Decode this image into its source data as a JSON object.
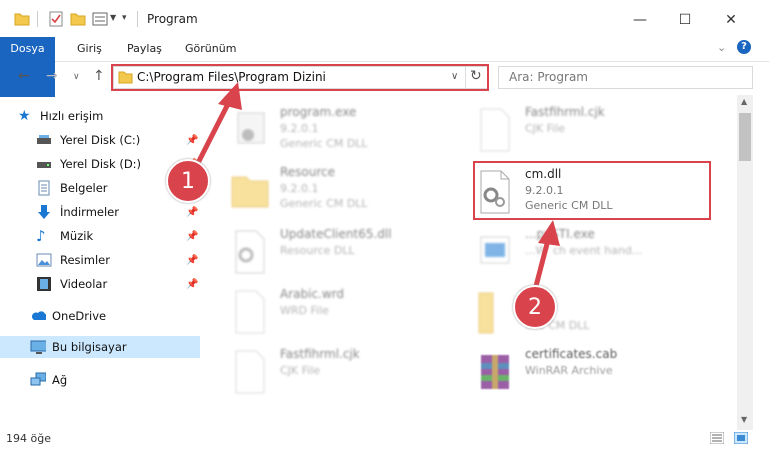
{
  "window": {
    "title": "Program"
  },
  "ribbon": {
    "tabs": [
      "Dosya",
      "Giriş",
      "Paylaş",
      "Görünüm"
    ]
  },
  "address": {
    "path": "C:\\Program Files\\Program Dizini"
  },
  "search": {
    "placeholder": "Ara: Program"
  },
  "sidebar": {
    "items": [
      {
        "label": "Hızlı erişim"
      },
      {
        "label": "Yerel Disk (C:)"
      },
      {
        "label": "Yerel Disk (D:)"
      },
      {
        "label": "Belgeler"
      },
      {
        "label": "İndirmeler"
      },
      {
        "label": "Müzik"
      },
      {
        "label": "Resimler"
      },
      {
        "label": "Videolar"
      },
      {
        "label": "OneDrive"
      },
      {
        "label": "Bu bilgisayar"
      },
      {
        "label": "Ağ"
      }
    ]
  },
  "files": [
    {
      "name": "program.exe",
      "line2": "9.2.0.1",
      "line3": "Generic CM DLL"
    },
    {
      "name": "Fastfihrml.cjk",
      "line2": "CJK File",
      "line3": ""
    },
    {
      "name": "Resource",
      "line2": "9.2.0.1",
      "line3": "Generic CM DLL"
    },
    {
      "name": "cm.dll",
      "line2": "9.2.0.1",
      "line3": "Generic CM DLL"
    },
    {
      "name": "UpdateClient65.dll",
      "line2": "Resource DLL",
      "line3": ""
    },
    {
      "name": "...pySTI.exe",
      "line2": "...W' ch event hand...",
      "line3": ""
    },
    {
      "name": "Arabic.wrd",
      "line2": "WRD File",
      "line3": ""
    },
    {
      "name": "",
      "line2": "",
      "line3": "...ic CM DLL"
    },
    {
      "name": "Fastfihrml.cjk",
      "line2": "CJK File",
      "line3": ""
    },
    {
      "name": "certificates.cab",
      "line2": "WinRAR Archive",
      "line3": ""
    }
  ],
  "status": {
    "count": "194 öğe"
  },
  "annotations": {
    "step1": "1",
    "step2": "2"
  },
  "colors": {
    "accent": "#1a65c0",
    "highlight": "#d9434b",
    "selected": "#cce8ff"
  }
}
